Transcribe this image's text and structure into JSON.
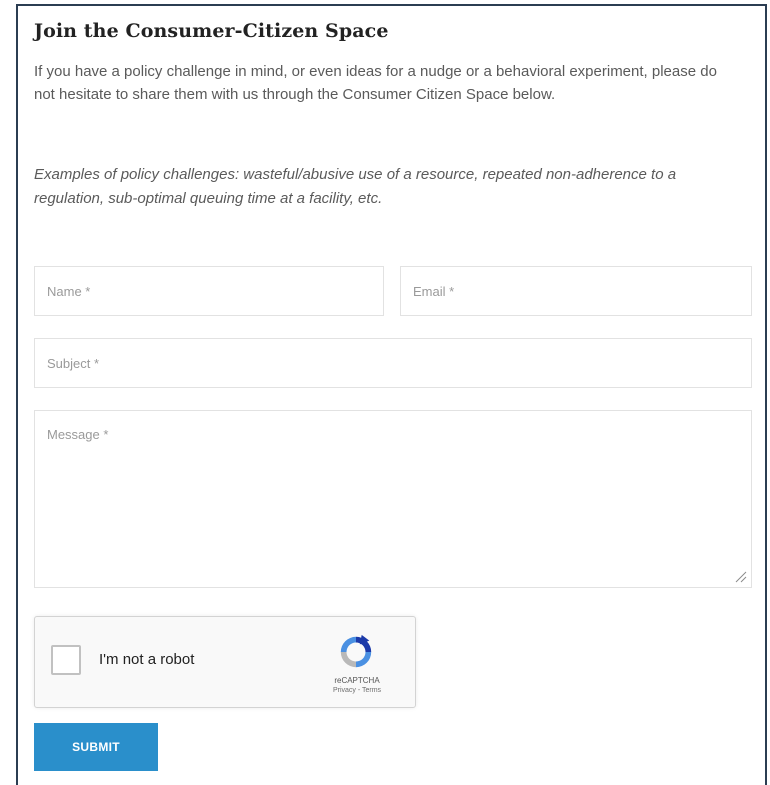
{
  "form": {
    "title": "Join the Consumer-Citizen Space",
    "intro": "If you have a policy challenge in mind, or even ideas for a nudge or a behavioral experiment, please do not hesitate to share them with us through the Consumer Citizen Space below.",
    "examples": "Examples of policy challenges: wasteful/abusive use of a resource, repeated non-adherence to a regulation, sub-optimal queuing time at a facility, etc.",
    "fields": {
      "name_placeholder": "Name *",
      "email_placeholder": "Email *",
      "subject_placeholder": "Subject *",
      "message_placeholder": "Message *"
    },
    "captcha": {
      "label": "I'm not a robot",
      "brand": "reCAPTCHA",
      "links": "Privacy - Terms",
      "logo_icon": "recaptcha-logo-icon"
    },
    "submit_label": "SUBMIT"
  },
  "colors": {
    "frame_border": "#2b3d52",
    "submit_bg": "#2a8fcb",
    "title_text": "#222222",
    "body_text": "#5a5a5a"
  }
}
